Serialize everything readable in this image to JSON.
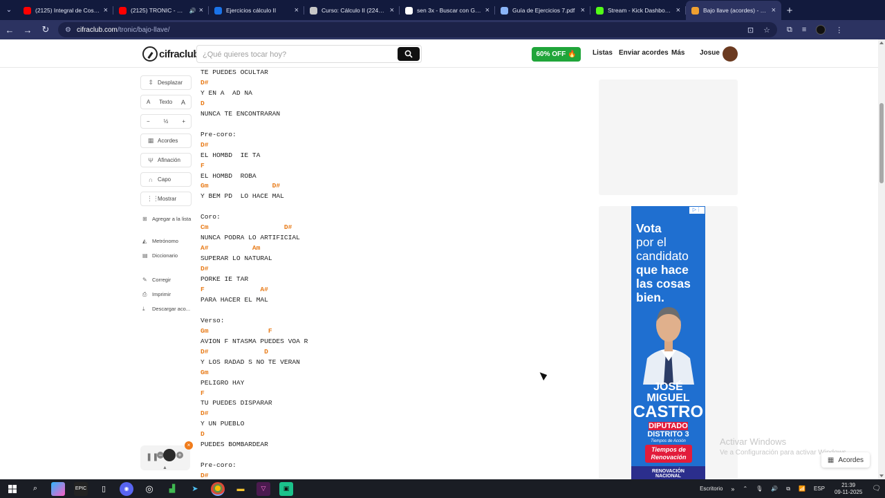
{
  "browser": {
    "tabs": [
      {
        "title": "(2125) Integral de Cosecante",
        "favicon_color": "#ff0000",
        "active": false,
        "extra": ""
      },
      {
        "title": "(2125) TRONIC - Mambo",
        "favicon_color": "#ff0000",
        "active": false,
        "extra": "🔊"
      },
      {
        "title": "Ejercicios cálculo II",
        "favicon_color": "#1a73e8",
        "active": false,
        "extra": ""
      },
      {
        "title": "Curso: Cálculo II (22403-C",
        "favicon_color": "#c7c7c7",
        "active": false,
        "extra": ""
      },
      {
        "title": "sen 3x - Buscar con Google",
        "favicon_color": "#ffffff",
        "active": false,
        "extra": ""
      },
      {
        "title": "Guía de Ejercicios 7.pdf",
        "favicon_color": "#8ab4f8",
        "active": false,
        "extra": ""
      },
      {
        "title": "Stream - Kick Dashboard",
        "favicon_color": "#53fc18",
        "active": false,
        "extra": ""
      },
      {
        "title": "Bajo llave (acordes) - Tronic",
        "favicon_color": "#f0a030",
        "active": true,
        "extra": ""
      }
    ],
    "tab_close": "×",
    "new_tab": "+",
    "url_host": "cifraclub.com",
    "url_path": "/tronic/bajo-llave/"
  },
  "header": {
    "logo": "cifraclub",
    "search_placeholder": "¿Qué quieres tocar hoy?",
    "promo": "60% OFF 🔥",
    "nav": [
      "Listas",
      "Enviar acordes",
      "Más"
    ],
    "user": "Josue"
  },
  "sidebar": {
    "scroll": "Desplazar",
    "text_a_small": "A",
    "text_label": "Texto",
    "text_a_big": "A",
    "step_minus": "−",
    "step_value": "½",
    "step_plus": "+",
    "chords": "Acordes",
    "tuning": "Afinación",
    "capo": "Capo",
    "show": "Mostrar",
    "links": [
      "Agregar a la lista",
      "Metrónomo",
      "Diccionario",
      "Corregir",
      "Imprimir",
      "Descargar aco..."
    ]
  },
  "sheet": [
    {
      "t": "l",
      "v": "TE PUEDES OCULTAR"
    },
    {
      "t": "c",
      "v": "D#"
    },
    {
      "t": "l",
      "v": "Y EN A  AD NA"
    },
    {
      "t": "c",
      "v": "D"
    },
    {
      "t": "l",
      "v": "NUNCA TE ENCONTRARAN"
    },
    {
      "t": "l",
      "v": ""
    },
    {
      "t": "l",
      "v": "Pre-coro:"
    },
    {
      "t": "c",
      "v": "D#"
    },
    {
      "t": "l",
      "v": "EL HOMBD  IE TA"
    },
    {
      "t": "c",
      "v": "F"
    },
    {
      "t": "l",
      "v": "EL HOMBD  ROBA"
    },
    {
      "t": "c",
      "v": "Gm                D#"
    },
    {
      "t": "l",
      "v": "Y BEM PD  LO HACE MAL"
    },
    {
      "t": "l",
      "v": ""
    },
    {
      "t": "l",
      "v": "Coro:"
    },
    {
      "t": "c",
      "v": "Cm                   D#"
    },
    {
      "t": "l",
      "v": "NUNCA PODRA LO ARTIFICIAL"
    },
    {
      "t": "c",
      "v": "A#           Am"
    },
    {
      "t": "l",
      "v": "SUPERAR LO NATURAL"
    },
    {
      "t": "c",
      "v": "D#"
    },
    {
      "t": "l",
      "v": "PORKE IE TAR"
    },
    {
      "t": "c",
      "v": "F              A#"
    },
    {
      "t": "l",
      "v": "PARA HACER EL MAL"
    },
    {
      "t": "l",
      "v": ""
    },
    {
      "t": "l",
      "v": "Verso:"
    },
    {
      "t": "c",
      "v": "Gm               F"
    },
    {
      "t": "l",
      "v": "AVION F NTASMA PUEDES VOA R"
    },
    {
      "t": "c",
      "v": "D#              D"
    },
    {
      "t": "l",
      "v": "Y LOS RADAD S NO TE VERAN"
    },
    {
      "t": "c",
      "v": "Gm"
    },
    {
      "t": "l",
      "v": "PELIGRO HAY"
    },
    {
      "t": "c",
      "v": "F"
    },
    {
      "t": "l",
      "v": "TU PUEDES DISPARAR"
    },
    {
      "t": "c",
      "v": "D#"
    },
    {
      "t": "l",
      "v": "Y UN PUEBLO"
    },
    {
      "t": "c",
      "v": "D"
    },
    {
      "t": "l",
      "v": "PUEDES BOMBARDEAR"
    },
    {
      "t": "l",
      "v": ""
    },
    {
      "t": "l",
      "v": "Pre-coro:"
    },
    {
      "t": "c",
      "v": "D#"
    }
  ],
  "ad": {
    "line1": "Vota",
    "line2": "por el",
    "line3": "candidato",
    "line4": "que hace",
    "line5": "las cosas",
    "line6": "bien.",
    "name1": "JOSÉ",
    "name2": "MIGUEL",
    "name3": "CASTRO",
    "diputado": "DIPUTADO",
    "distrito": "DISTRITO 3",
    "tiempos_small": "Tiempos de Acción",
    "tiempos_big1": "Tiempos de",
    "tiempos_big2": "Renovación",
    "party1": "RENOVACIÓN",
    "party2": "NACIONAL"
  },
  "watermark": {
    "line1": "Activar Windows",
    "line2": "Ve a Configuración para activar Windows."
  },
  "acordes_button": "Acordes",
  "taskbar": {
    "tray_label": "Escritorio",
    "lang": "ESP",
    "time": "21:39",
    "date": "09-11-2025"
  }
}
